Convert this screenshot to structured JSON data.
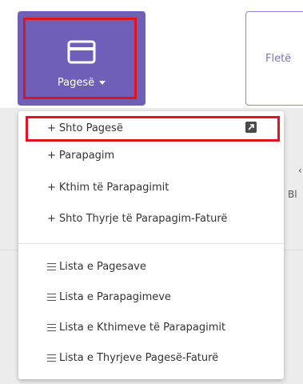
{
  "toolbar": {
    "payments_label": "Pagesë",
    "second_label": "Fletë",
    "partial_label": "Bl"
  },
  "menu": {
    "add_items": [
      {
        "prefix": "+",
        "label": "Shto Pagesë",
        "icon": "external-link-icon"
      },
      {
        "prefix": "+",
        "label": "Parapagim"
      },
      {
        "prefix": "+",
        "label": "Kthim të Parapagimit"
      },
      {
        "prefix": "+",
        "label": "Shto Thyrje të Parapagim-Faturë"
      }
    ],
    "list_items": [
      {
        "icon": "list-icon",
        "label": "Lista e Pagesave"
      },
      {
        "icon": "list-icon",
        "label": "Lista e Parapagimeve"
      },
      {
        "icon": "list-icon",
        "label": "Lista e Kthimeve të Parapagimit"
      },
      {
        "icon": "list-icon",
        "label": "Lista e Thyrjeve Pagesë-Faturë"
      }
    ]
  },
  "colors": {
    "accent": "#6f5fb8",
    "highlight": "#e0141e"
  }
}
